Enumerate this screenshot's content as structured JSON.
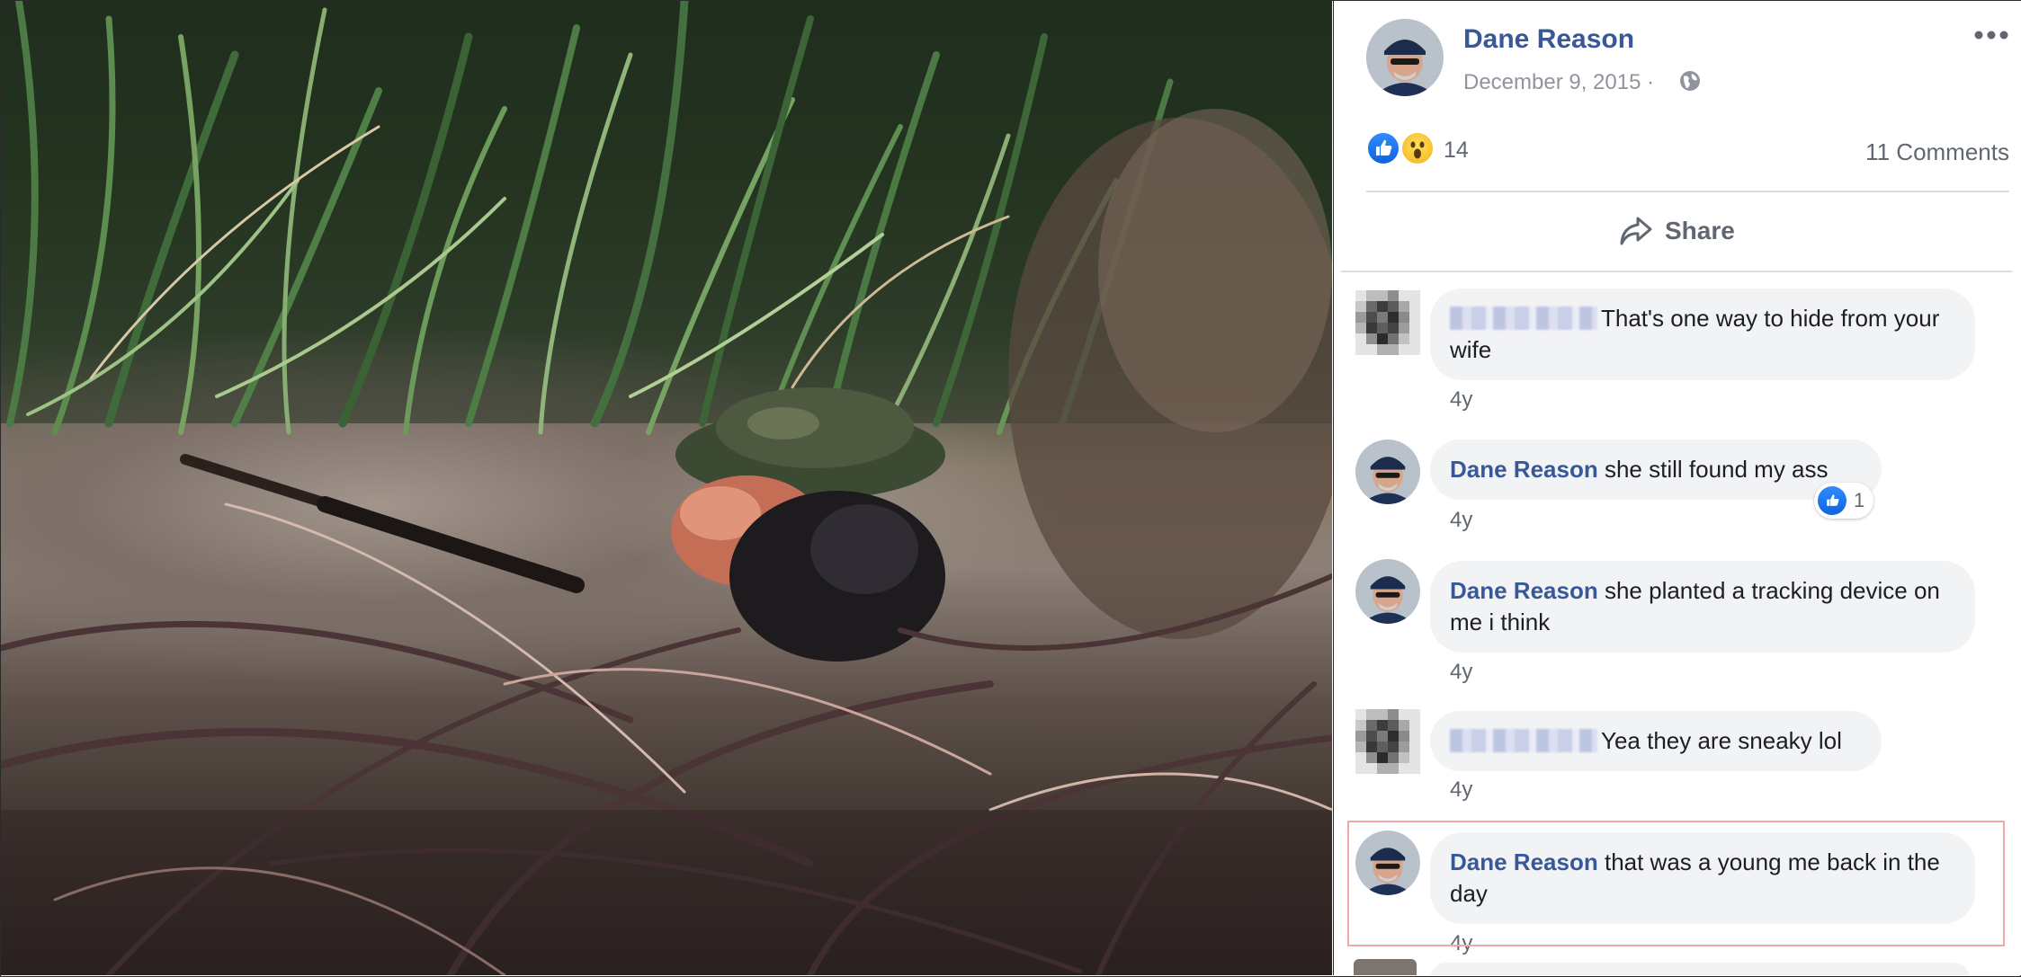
{
  "post": {
    "author": "Dane Reason",
    "date": "December 9, 2015",
    "date_separator": "·",
    "privacy_icon": "globe-icon",
    "reaction_count": "14",
    "comments_count": "11 Comments",
    "share_label": "Share"
  },
  "comments": [
    {
      "author": "",
      "author_blurred": true,
      "text": "That's one way to hide from your wife",
      "time": "4y"
    },
    {
      "author": "Dane Reason",
      "text": "she still found my ass",
      "time": "4y",
      "likes": "1"
    },
    {
      "author": "Dane Reason",
      "text": "she planted a tracking device on me i think",
      "time": "4y"
    },
    {
      "author": "",
      "author_blurred": true,
      "text": "Yea they are sneaky lol",
      "time": "4y"
    },
    {
      "author": "Dane Reason",
      "text": "that was a young me back in the day",
      "time": "4y",
      "highlighted": true
    }
  ],
  "colors": {
    "link": "#385898",
    "muted": "#606770",
    "bubble": "#f2f3f5",
    "like_blue": "#1877f2",
    "highlight_border": "#f0a8ad"
  }
}
